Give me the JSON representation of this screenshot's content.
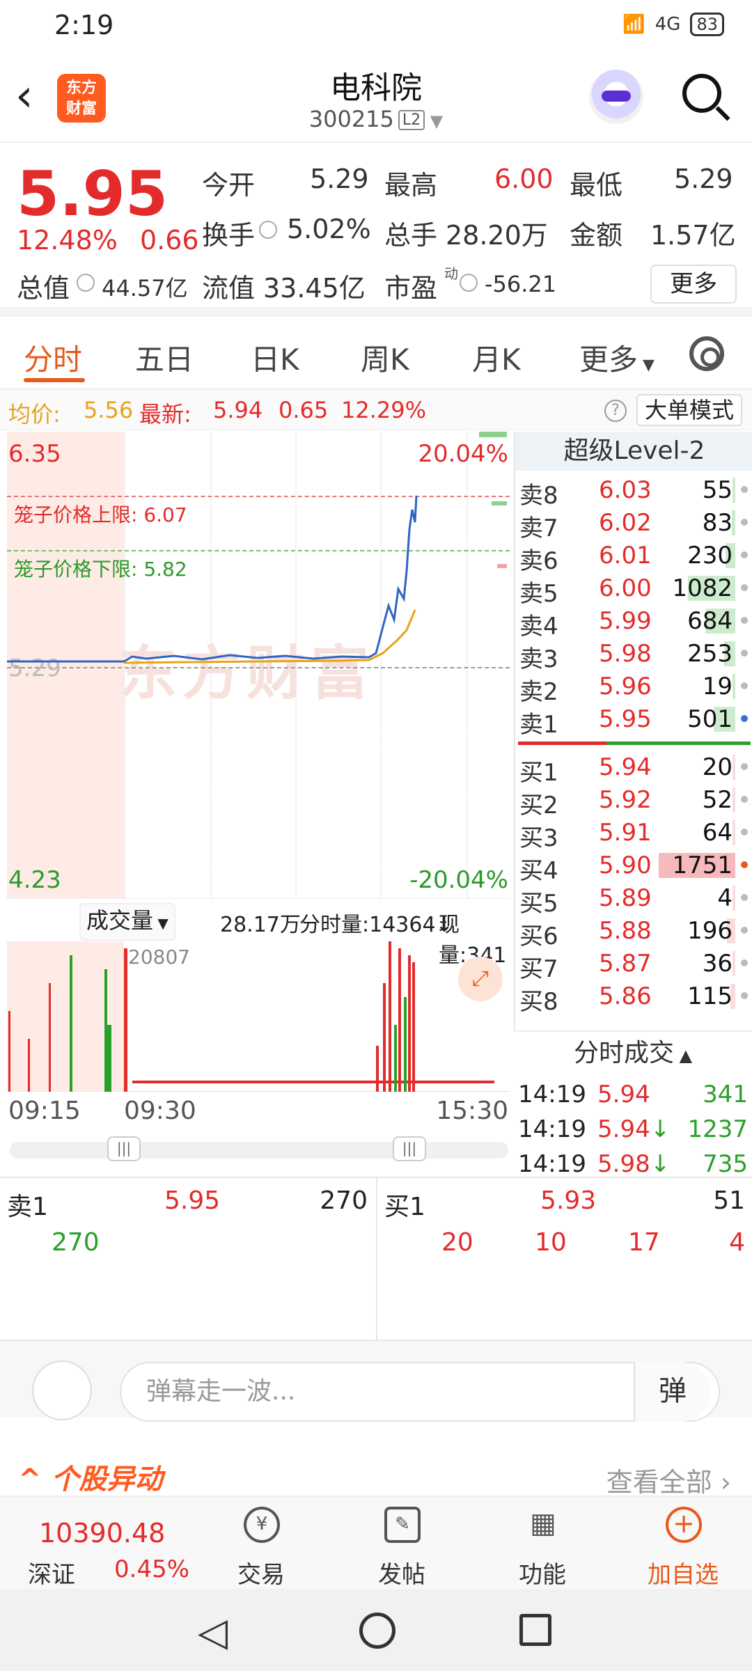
{
  "status": {
    "time": "2:19",
    "signal": "4G",
    "battery": "83"
  },
  "header": {
    "title": "电科院",
    "code": "300215",
    "level": "L2",
    "logo_top": "东方",
    "logo_bottom": "财富"
  },
  "quote": {
    "price": "5.95",
    "pct": "12.48%",
    "change": "0.66",
    "open_label": "今开",
    "open": "5.29",
    "high_label": "最高",
    "high": "6.00",
    "low_label": "最低",
    "low": "5.29",
    "turnover_label": "换手",
    "turnover": "5.02%",
    "volume_label": "总手",
    "volume": "28.20万",
    "amount_label": "金额",
    "amount": "1.57亿",
    "mktcap_label": "总值",
    "mktcap": "44.57亿",
    "float_label": "流值",
    "float": "33.45亿",
    "pe_label": "市盈",
    "pe_sup": "动",
    "pe": "-56.21",
    "more": "更多"
  },
  "tabs": [
    "分时",
    "五日",
    "日K",
    "周K",
    "月K",
    "更多"
  ],
  "infobar": {
    "avg_label": "均价:",
    "avg": "5.56",
    "latest_label": "最新:",
    "latest": "5.94",
    "chg": "0.65",
    "pct": "12.29%",
    "mode": "大单模式"
  },
  "chart": {
    "top_price": "6.35",
    "top_pct": "20.04%",
    "bottom_price": "4.23",
    "bottom_pct": "-20.04%",
    "ref": "5.29",
    "cage_up": "笼子价格上限: 6.07",
    "cage_down": "笼子价格下限: 5.82",
    "watermark": "东方财富"
  },
  "volume_area": {
    "label": "成交量",
    "total": "28.17万",
    "per_min": "分时量:14364↓",
    "now": "现量:341",
    "max": "20807",
    "times": [
      "09:15",
      "09:30",
      "15:30"
    ]
  },
  "book": {
    "title": "超级Level-2",
    "asks": [
      {
        "l": "卖8",
        "p": "6.03",
        "v": "55"
      },
      {
        "l": "卖7",
        "p": "6.02",
        "v": "83"
      },
      {
        "l": "卖6",
        "p": "6.01",
        "v": "230"
      },
      {
        "l": "卖5",
        "p": "6.00",
        "v": "1082"
      },
      {
        "l": "卖4",
        "p": "5.99",
        "v": "684"
      },
      {
        "l": "卖3",
        "p": "5.98",
        "v": "253"
      },
      {
        "l": "卖2",
        "p": "5.96",
        "v": "19"
      },
      {
        "l": "卖1",
        "p": "5.95",
        "v": "501"
      }
    ],
    "bids": [
      {
        "l": "买1",
        "p": "5.94",
        "v": "20"
      },
      {
        "l": "买2",
        "p": "5.92",
        "v": "52"
      },
      {
        "l": "买3",
        "p": "5.91",
        "v": "64"
      },
      {
        "l": "买4",
        "p": "5.90",
        "v": "1751"
      },
      {
        "l": "买5",
        "p": "5.89",
        "v": "4"
      },
      {
        "l": "买6",
        "p": "5.88",
        "v": "196"
      },
      {
        "l": "买7",
        "p": "5.87",
        "v": "36"
      },
      {
        "l": "买8",
        "p": "5.86",
        "v": "115"
      }
    ]
  },
  "trades": {
    "title": "分时成交",
    "rows": [
      {
        "t": "14:19",
        "p": "5.94",
        "v": "341"
      },
      {
        "t": "14:19",
        "p": "5.94",
        "v": "1237",
        "arrow": "↓"
      },
      {
        "t": "14:19",
        "p": "5.98",
        "v": "735",
        "arrow": "↓"
      }
    ]
  },
  "level1": {
    "sell_label": "卖1",
    "sell_price": "5.95",
    "sell_vol": "270",
    "sell_q": [
      "270"
    ],
    "buy_label": "买1",
    "buy_price": "5.93",
    "buy_vol": "51",
    "buy_q": [
      "20",
      "10",
      "17",
      "4"
    ]
  },
  "danmaku": {
    "placeholder": "弹幕走一波...",
    "btn": "弹"
  },
  "anomaly": {
    "title": "个股异动",
    "link": "查看全部"
  },
  "nav": {
    "index_value": "10390.48",
    "index_name": "深证",
    "index_pct": "0.45%",
    "items": [
      "交易",
      "发帖",
      "功能",
      "加自选"
    ]
  }
}
